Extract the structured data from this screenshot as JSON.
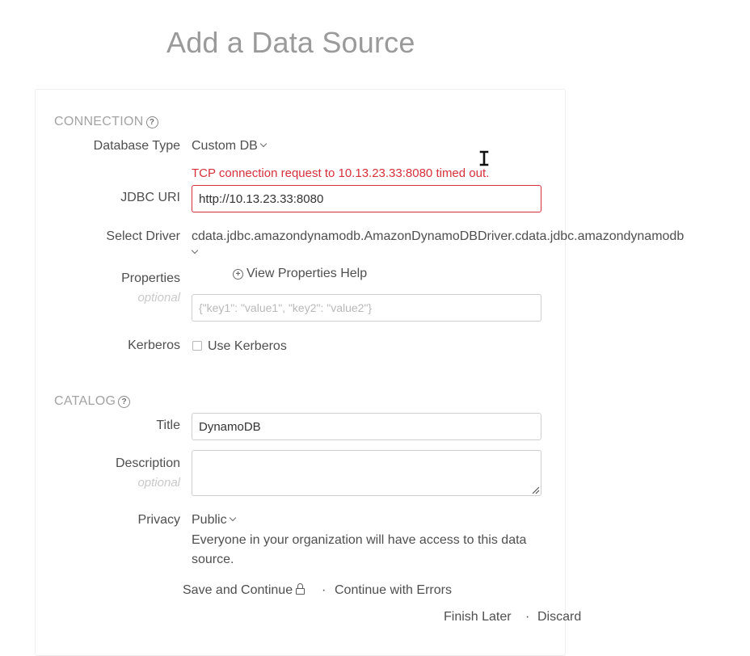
{
  "page": {
    "title": "Add a Data Source"
  },
  "connection": {
    "section_title": "CONNECTION",
    "database_type": {
      "label": "Database Type",
      "value": "Custom DB"
    },
    "error_message": "TCP connection request to 10.13.23.33:8080 timed out.",
    "jdbc_uri": {
      "label": "JDBC URI",
      "value": "http://10.13.23.33:8080"
    },
    "select_driver": {
      "label": "Select Driver",
      "value": "cdata.jdbc.amazondynamodb.AmazonDynamoDBDriver.cdata.jdbc.amazondynamodb"
    },
    "properties": {
      "label": "Properties",
      "sublabel": "optional",
      "help_link": "View Properties Help",
      "placeholder": "{\"key1\": \"value1\", \"key2\": \"value2\"}"
    },
    "kerberos": {
      "label": "Kerberos",
      "checkbox_label": "Use Kerberos",
      "checked": false
    }
  },
  "catalog": {
    "section_title": "CATALOG",
    "title": {
      "label": "Title",
      "value": "DynamoDB"
    },
    "description": {
      "label": "Description",
      "sublabel": "optional",
      "value": ""
    },
    "privacy": {
      "label": "Privacy",
      "value": "Public",
      "description": "Everyone in your organization will have access to this data source."
    }
  },
  "actions": {
    "save_and_continue": "Save and Continue",
    "separator": "·",
    "continue_with_errors": "Continue with Errors",
    "finish_later": "Finish Later",
    "discard": "Discard"
  },
  "colors": {
    "error": "#d6303b",
    "section_title": "#a3a3a3",
    "page_title": "#9a9a9a"
  },
  "icons": [
    "help-circle-icon",
    "chevron-down-icon",
    "plus-circle-icon",
    "lock-icon",
    "text-cursor-icon",
    "resize-grip-icon"
  ]
}
